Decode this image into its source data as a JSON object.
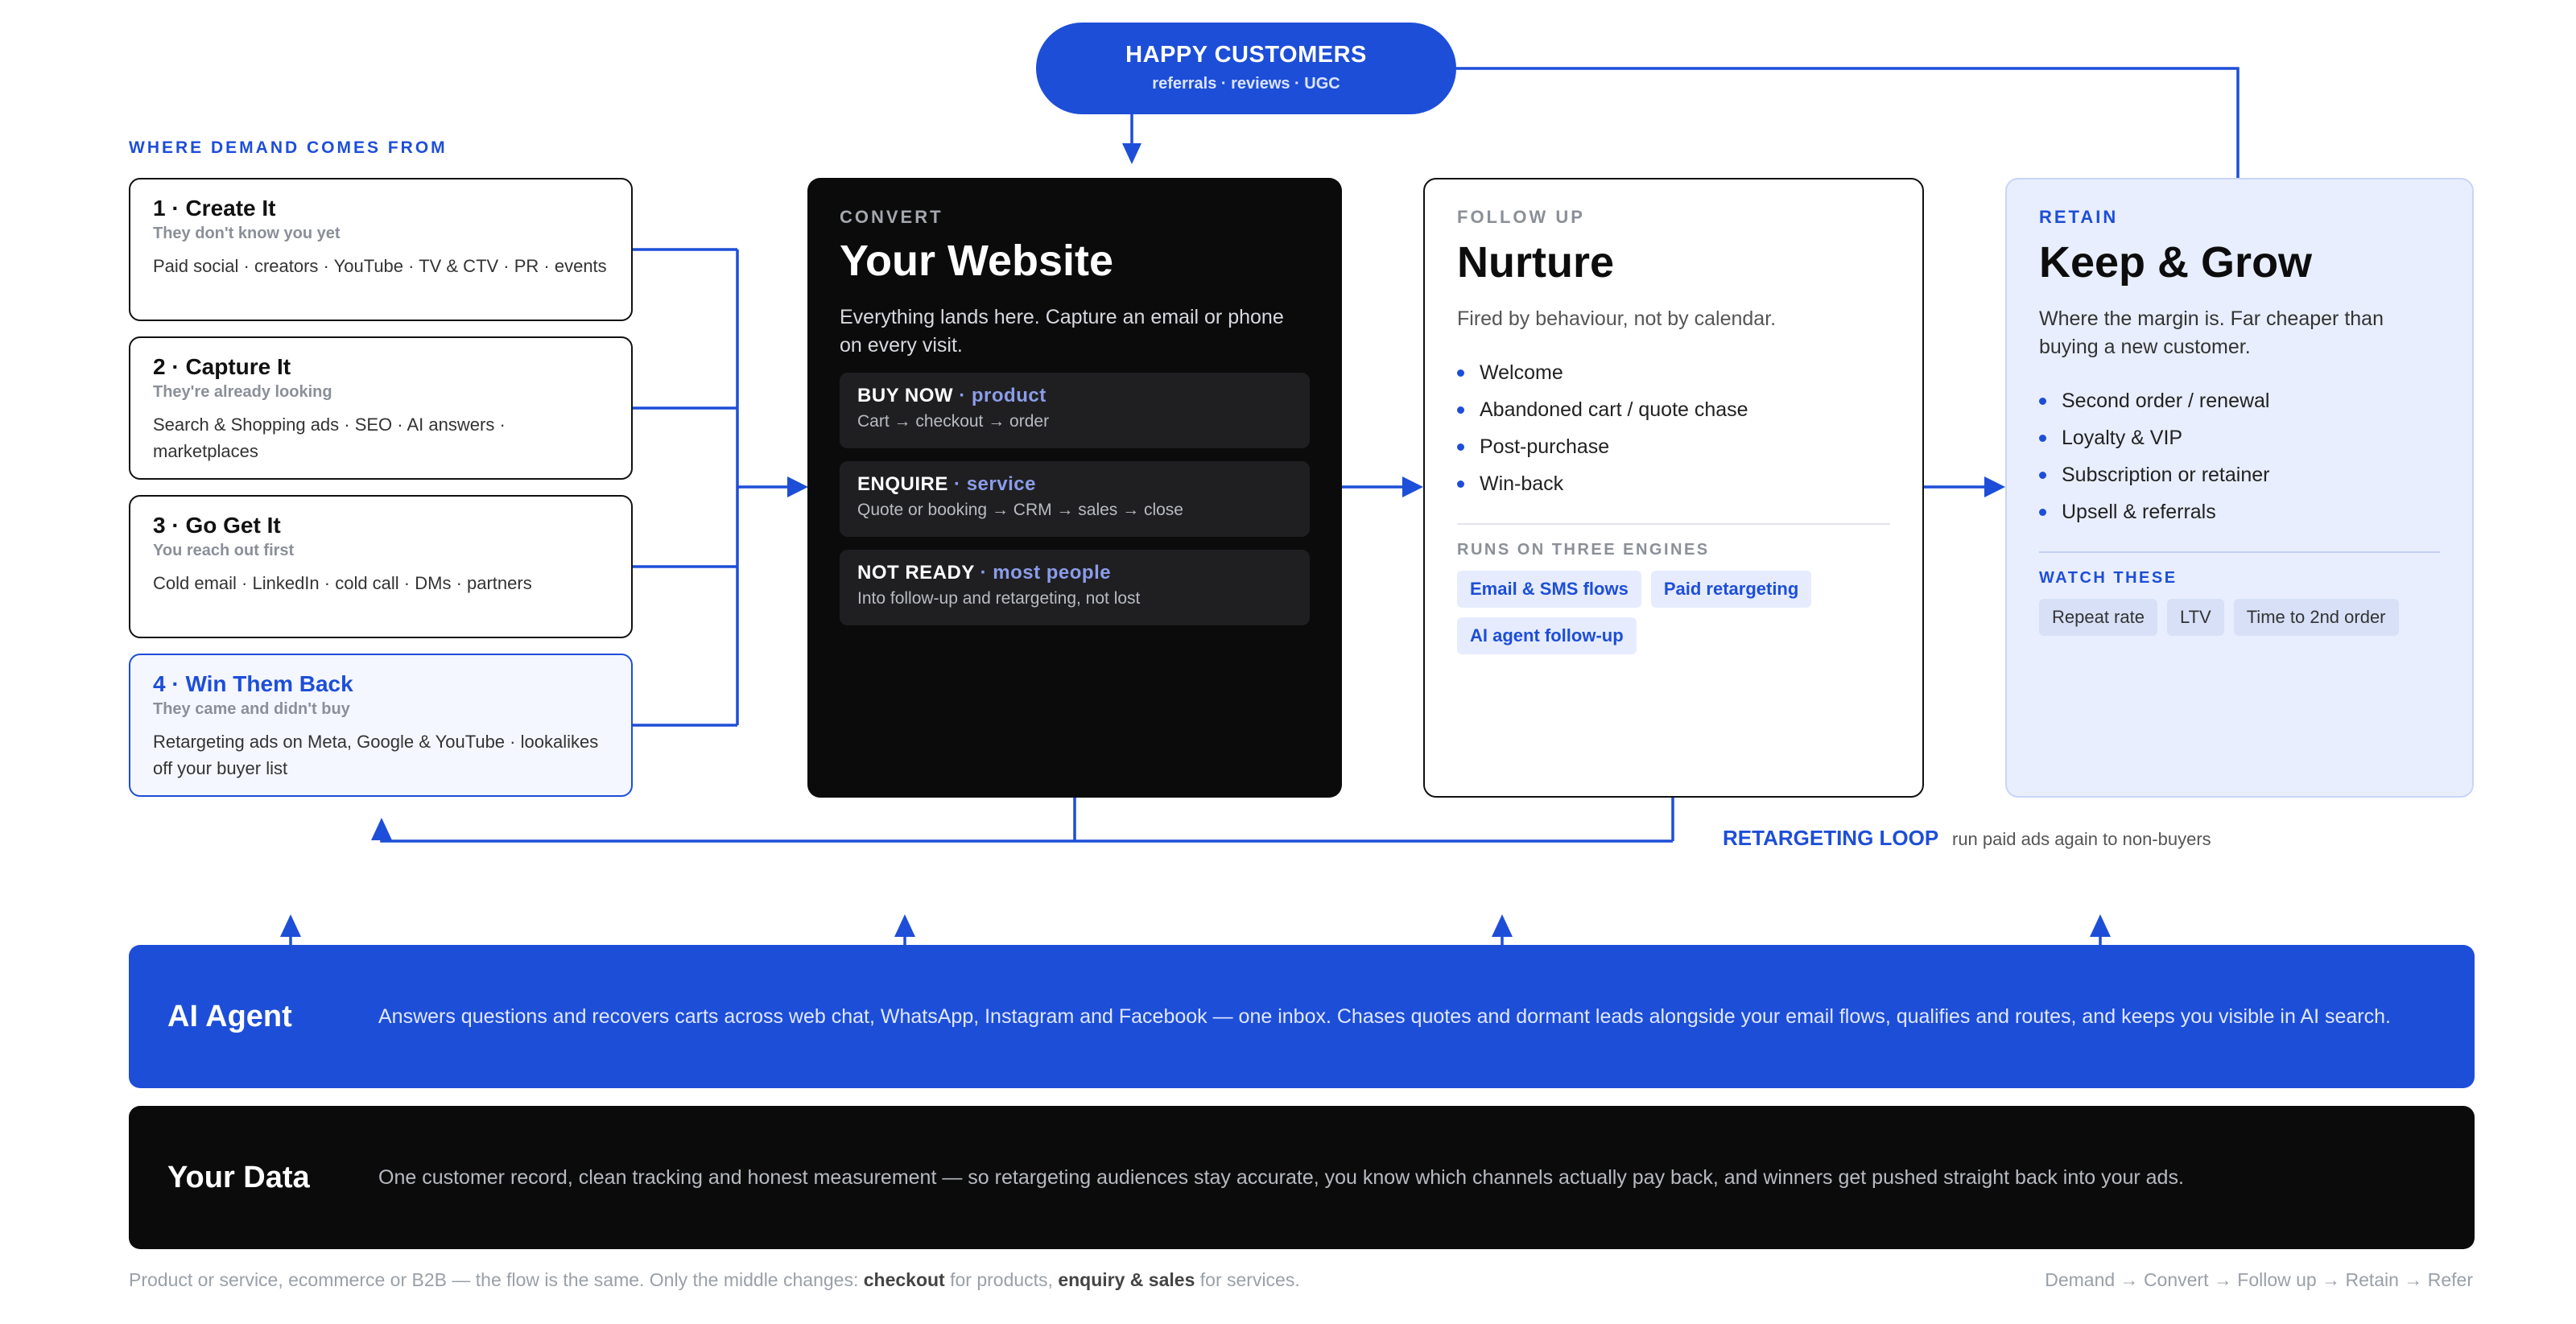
{
  "top": {
    "title": "HAPPY CUSTOMERS",
    "subtitle": "referrals · reviews · UGC"
  },
  "demand": {
    "heading": "WHERE DEMAND COMES FROM",
    "cards": [
      {
        "title": "1 · Create It",
        "sub": "They don't know you yet",
        "body": "Paid social · creators · YouTube · TV & CTV · PR · events"
      },
      {
        "title": "2 · Capture It",
        "sub": "They're already looking",
        "body": "Search & Shopping ads · SEO · AI answers · marketplaces"
      },
      {
        "title": "3 · Go Get It",
        "sub": "You reach out first",
        "body": "Cold email · LinkedIn · cold call · DMs · partners"
      },
      {
        "title": "4 · Win Them Back",
        "sub": "They came and didn't buy",
        "body": "Retargeting ads on Meta, Google & YouTube · lookalikes off your buyer list"
      }
    ]
  },
  "website": {
    "eyebrow": "CONVERT",
    "title": "Your Website",
    "desc": "Everything lands here. Capture an email or phone on every visit.",
    "options": [
      {
        "key": "BUY NOW",
        "sep": " · ",
        "accent": "product",
        "detail": "Cart → checkout → order"
      },
      {
        "key": "ENQUIRE",
        "sep": " · ",
        "accent": "service",
        "detail": "Quote or booking → CRM → sales → close"
      },
      {
        "key": "NOT READY",
        "sep": " · ",
        "accent": "most people",
        "detail": "Into follow-up and retargeting, not lost"
      }
    ]
  },
  "nurture": {
    "eyebrow": "FOLLOW UP",
    "title": "Nurture",
    "desc": "Fired by behaviour, not by calendar.",
    "items": [
      "Welcome",
      "Abandoned cart / quote chase",
      "Post-purchase",
      "Win-back"
    ],
    "engines_label": "RUNS ON THREE ENGINES",
    "engines": [
      "Email & SMS flows",
      "Paid retargeting",
      "AI agent follow-up"
    ]
  },
  "retain": {
    "eyebrow": "RETAIN",
    "title": "Keep & Grow",
    "desc": "Where the margin is. Far cheaper than buying a new customer.",
    "items": [
      "Second order / renewal",
      "Loyalty & VIP",
      "Subscription or retainer",
      "Upsell & referrals"
    ],
    "watch_label": "WATCH THESE",
    "watch": [
      "Repeat rate",
      "LTV",
      "Time to 2nd order"
    ]
  },
  "loop": {
    "label": "RETARGETING LOOP",
    "desc": "run paid ads again to non-buyers"
  },
  "ai_agent": {
    "name": "AI Agent",
    "text": "Answers questions and recovers carts across web chat, WhatsApp, Instagram and Facebook — one inbox. Chases quotes and dormant leads alongside your email flows, qualifies and routes, and keeps you visible in AI search."
  },
  "your_data": {
    "name": "Your Data",
    "text": "One customer record, clean tracking and honest measurement — so retargeting audiences stay accurate, you know which channels actually pay back, and winners get pushed straight back into your ads."
  },
  "footer": {
    "pre": "Product or service, ecommerce or B2B — the flow is the same. Only the middle changes: ",
    "b1": "checkout",
    "mid": " for products, ",
    "b2": "enquiry & sales",
    "post": " for services.",
    "flow": "Demand → Convert → Follow up → Retain → Refer"
  },
  "colors": {
    "accent": "#1d4ed8",
    "dark": "#0b0b0c",
    "retain_bg": "#e8eefd"
  }
}
